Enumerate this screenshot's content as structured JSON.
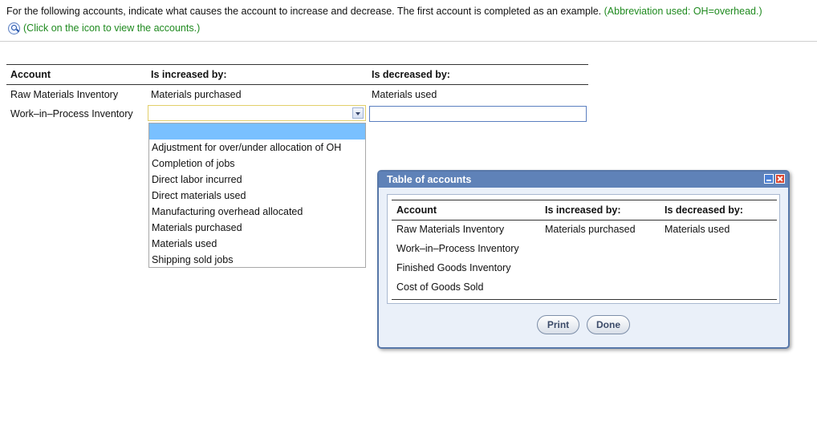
{
  "instructions": {
    "text": "For the following accounts, indicate what causes the account to increase and decrease. The first account is completed as an example.",
    "abbreviation": "(Abbreviation used: OH=overhead.)",
    "hint": "(Click on the icon to view the accounts.)",
    "icon": "magnifier-icon"
  },
  "main_table": {
    "headers": [
      "Account",
      "Is increased by:",
      "Is decreased by:"
    ],
    "rows": [
      {
        "account": "Raw Materials Inventory",
        "increased": "Materials purchased",
        "decreased": "Materials used"
      },
      {
        "account": "Work–in–Process Inventory",
        "increased": "",
        "decreased": ""
      }
    ]
  },
  "dropdown": {
    "selected": "",
    "options": [
      "Adjustment for over/under allocation of OH",
      "Completion of jobs",
      "Direct labor incurred",
      "Direct materials used",
      "Manufacturing overhead allocated",
      "Materials purchased",
      "Materials used",
      "Shipping sold jobs"
    ]
  },
  "dialog": {
    "title": "Table of accounts",
    "headers": [
      "Account",
      "Is increased by:",
      "Is decreased by:"
    ],
    "rows": [
      {
        "account": "Raw Materials Inventory",
        "increased": "Materials purchased",
        "decreased": "Materials used"
      },
      {
        "account": "Work–in–Process Inventory",
        "increased": "",
        "decreased": ""
      },
      {
        "account": "Finished Goods Inventory",
        "increased": "",
        "decreased": ""
      },
      {
        "account": "Cost of Goods Sold",
        "increased": "",
        "decreased": ""
      }
    ],
    "print_label": "Print",
    "done_label": "Done"
  },
  "colors": {
    "hint_green": "#1f8a1f",
    "dialog_title": "#5f82b8",
    "dropdown_highlight": "#79c0ff"
  }
}
